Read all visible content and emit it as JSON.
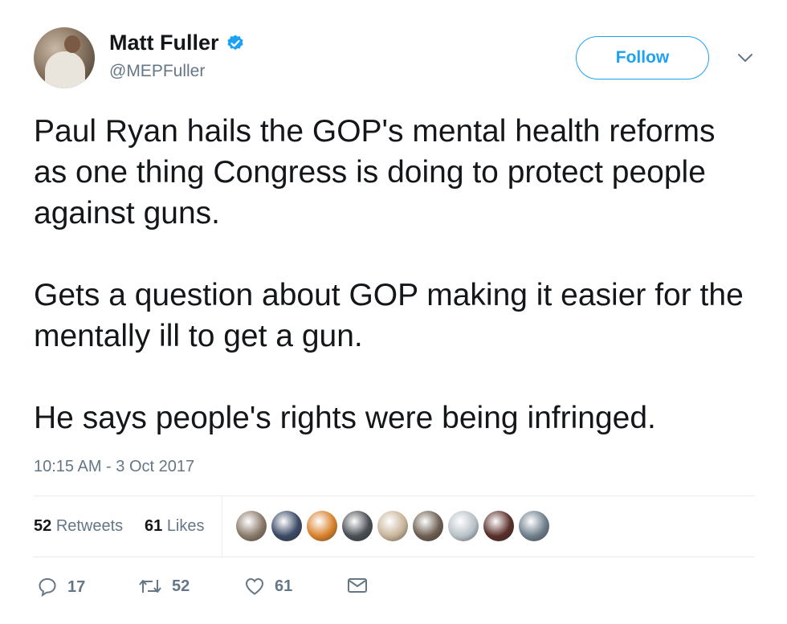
{
  "author": {
    "name": "Matt Fuller",
    "handle": "@MEPFuller",
    "verified": true
  },
  "follow_label": "Follow",
  "tweet": {
    "paragraphs": [
      "Paul Ryan hails the GOP's mental health reforms as one thing Congress is doing to protect people against guns.",
      "Gets a question about GOP making it easier for the mentally ill to get a gun.",
      "He says people's rights were being infringed."
    ],
    "timestamp": "10:15 AM - 3 Oct 2017"
  },
  "stats": {
    "retweets_count": "52",
    "retweets_label": "Retweets",
    "likes_count": "61",
    "likes_label": "Likes"
  },
  "likers": [
    {
      "color": "#8a7a6a"
    },
    {
      "color": "#3b4a66"
    },
    {
      "color": "#d9822b"
    },
    {
      "color": "#4a4f55"
    },
    {
      "color": "#c9b59a"
    },
    {
      "color": "#6d5f52"
    },
    {
      "color": "#b8c2c8"
    },
    {
      "color": "#5a2f2a"
    },
    {
      "color": "#6f7f8c"
    }
  ],
  "actions": {
    "reply_count": "17",
    "retweet_count": "52",
    "like_count": "61"
  },
  "colors": {
    "accent": "#1da1f2",
    "text": "#14171a",
    "secondary": "#657786",
    "divider": "#e6ecf0"
  }
}
